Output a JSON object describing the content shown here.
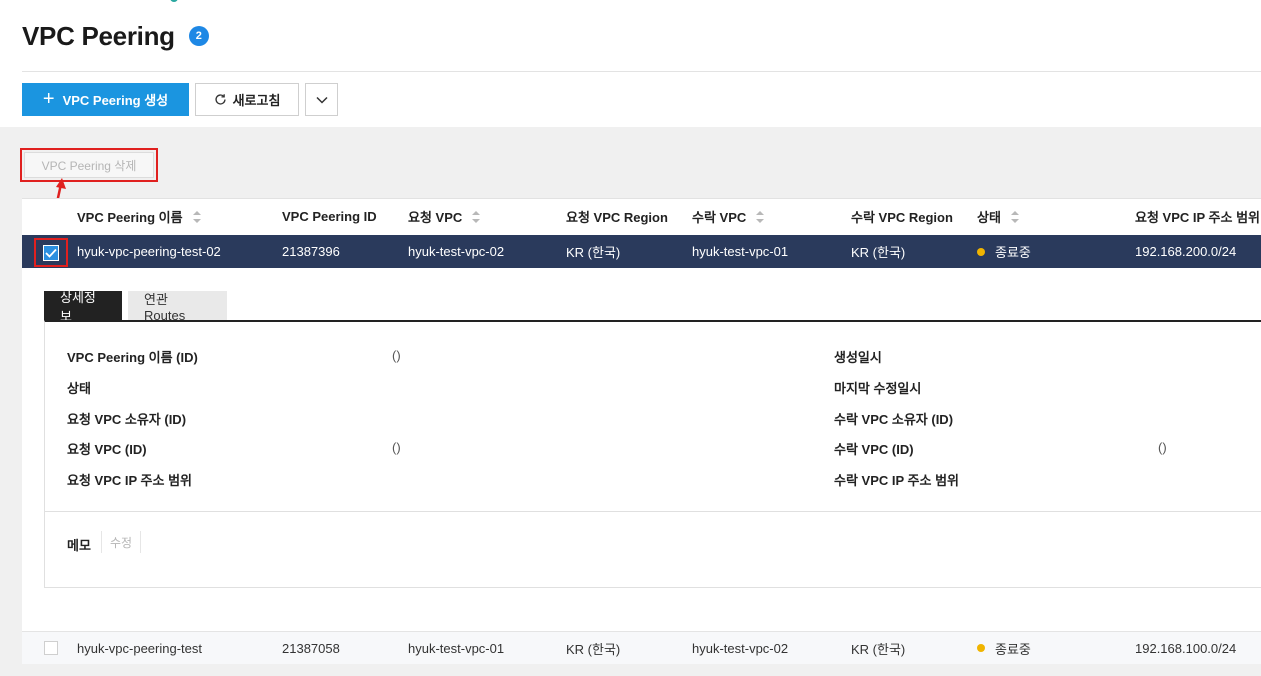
{
  "page": {
    "title": "VPC Peering",
    "count": "2"
  },
  "toolbar": {
    "create_label": "VPC Peering 생성",
    "refresh_label": "새로고침",
    "delete_label": "VPC Peering 삭제"
  },
  "table": {
    "headers": [
      "VPC Peering 이름",
      "VPC Peering ID",
      "요청 VPC",
      "요청 VPC Region",
      "수락 VPC",
      "수락 VPC Region",
      "상태",
      "요청 VPC IP 주소 범위"
    ],
    "rows": [
      {
        "name": "hyuk-vpc-peering-test-02",
        "id": "21387396",
        "request_vpc": "hyuk-test-vpc-02",
        "request_region": "KR (한국)",
        "accept_vpc": "hyuk-test-vpc-01",
        "accept_region": "KR (한국)",
        "status": "종료중",
        "request_ip": "192.168.200.0/24",
        "selected": true
      },
      {
        "name": "hyuk-vpc-peering-test",
        "id": "21387058",
        "request_vpc": "hyuk-test-vpc-01",
        "request_region": "KR (한국)",
        "accept_vpc": "hyuk-test-vpc-02",
        "accept_region": "KR (한국)",
        "status": "종료중",
        "request_ip": "192.168.100.0/24",
        "selected": false
      }
    ]
  },
  "detail": {
    "tabs": [
      "상세정보",
      "연관 Routes"
    ],
    "left_labels": [
      "VPC Peering 이름 (ID)",
      "상태",
      "요청 VPC 소유자 (ID)",
      "요청 VPC (ID)",
      "요청 VPC IP 주소 범위"
    ],
    "left_values": [
      "()",
      "",
      "",
      "()",
      ""
    ],
    "right_labels": [
      "생성일시",
      "마지막 수정일시",
      "수락 VPC 소유자 (ID)",
      "수락 VPC (ID)",
      "수락 VPC IP 주소 범위"
    ],
    "right_values": [
      "",
      "",
      "",
      "()",
      ""
    ],
    "memo_label": "메모",
    "memo_edit": "수정"
  },
  "colors": {
    "primary": "#1b95e0",
    "selected_row": "#2a3a5c",
    "status_dot": "#f0b400",
    "annotation": "#e0201f"
  }
}
